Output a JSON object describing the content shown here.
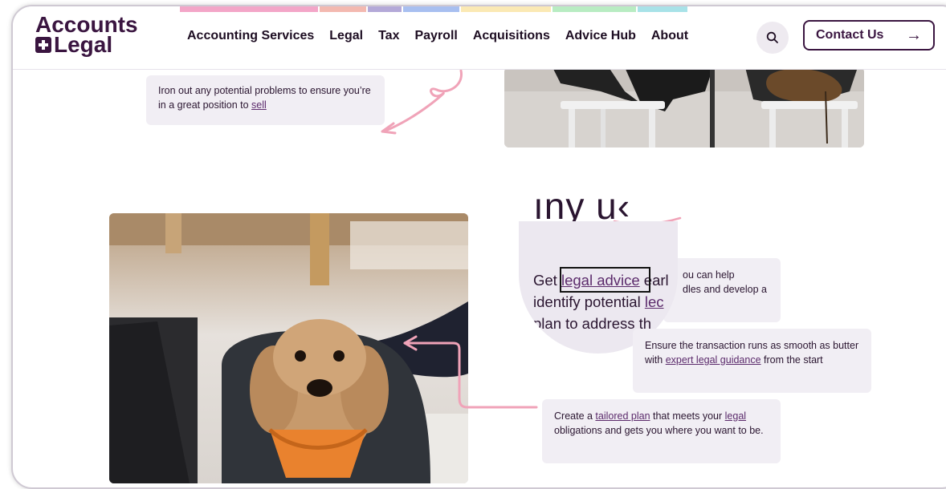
{
  "header": {
    "logo_line1": "Accounts",
    "logo_line2": "Legal",
    "nav": [
      "Accounting Services",
      "Legal",
      "Tax",
      "Payroll",
      "Acquisitions",
      "Advice Hub",
      "About"
    ],
    "search_icon": "search-icon",
    "contact_label": "Contact Us",
    "contact_icon": "→"
  },
  "colorbar": [
    "#f3a6c8",
    "#f3b9b0",
    "#b4a9d8",
    "#a8bff0",
    "#fbe9b4",
    "#b8ecc2",
    "#a8e2e8"
  ],
  "top_card": {
    "text": "Iron out any potential problems to ensure you’re in a great position to ",
    "link": "sell"
  },
  "section_heading": "ıny u‹",
  "lens": {
    "line1_pre": "Get ",
    "line1_link": "legal advice",
    "line1_post": " earl",
    "line2_pre": "identify potential ",
    "line2_link": "lec",
    "line3": "plan to address th"
  },
  "cards": {
    "card1_line1": "ou can help",
    "card1_line2": "dles and develop a",
    "card2_pre": "Ensure the transaction runs as smooth as butter with ",
    "card2_link": "expert legal guidance",
    "card2_post": " from the start",
    "card3_pre": "Create a ",
    "card3_link1": "tailored plan",
    "card3_mid": " that meets your ",
    "card3_link2": "legal",
    "card3_post": " obligations and gets you where you want to be."
  },
  "colors": {
    "accent": "#3a1540",
    "pink_arrow": "#f0a3b8",
    "card_bg": "#f1eef4"
  }
}
